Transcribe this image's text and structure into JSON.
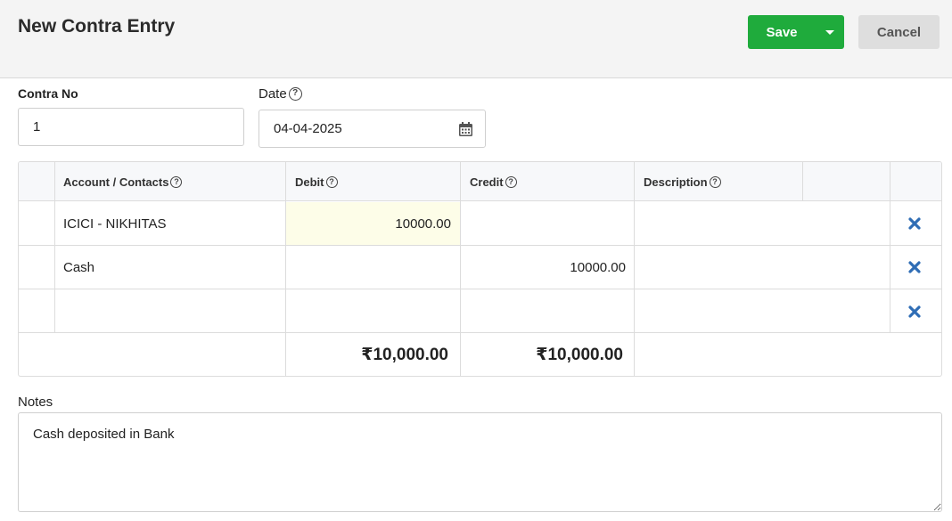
{
  "header": {
    "title": "New Contra Entry",
    "save_label": "Save",
    "cancel_label": "Cancel"
  },
  "form": {
    "contra_no_label": "Contra No",
    "contra_no_value": "1",
    "date_label": "Date",
    "date_value": "04-04-2025"
  },
  "grid": {
    "columns": [
      "Account / Contacts",
      "Debit",
      "Credit",
      "Description"
    ],
    "rows": [
      {
        "account": "ICICI - NIKHITAS",
        "debit": "10000.00",
        "credit": "",
        "description": ""
      },
      {
        "account": "Cash",
        "debit": "",
        "credit": "10000.00",
        "description": ""
      },
      {
        "account": "",
        "debit": "",
        "credit": "",
        "description": ""
      }
    ],
    "totals": {
      "debit": "₹10,000.00",
      "credit": "₹10,000.00"
    }
  },
  "notes": {
    "label": "Notes",
    "value": "Cash deposited in Bank"
  },
  "icons": {
    "help": "question-circle-icon",
    "calendar": "calendar-icon",
    "delete": "times-icon",
    "dropdown": "caret-down-icon"
  },
  "colors": {
    "save_button": "#1fab3c",
    "delete_icon": "#2f6db5",
    "debit_highlight": "#fdfde8"
  }
}
